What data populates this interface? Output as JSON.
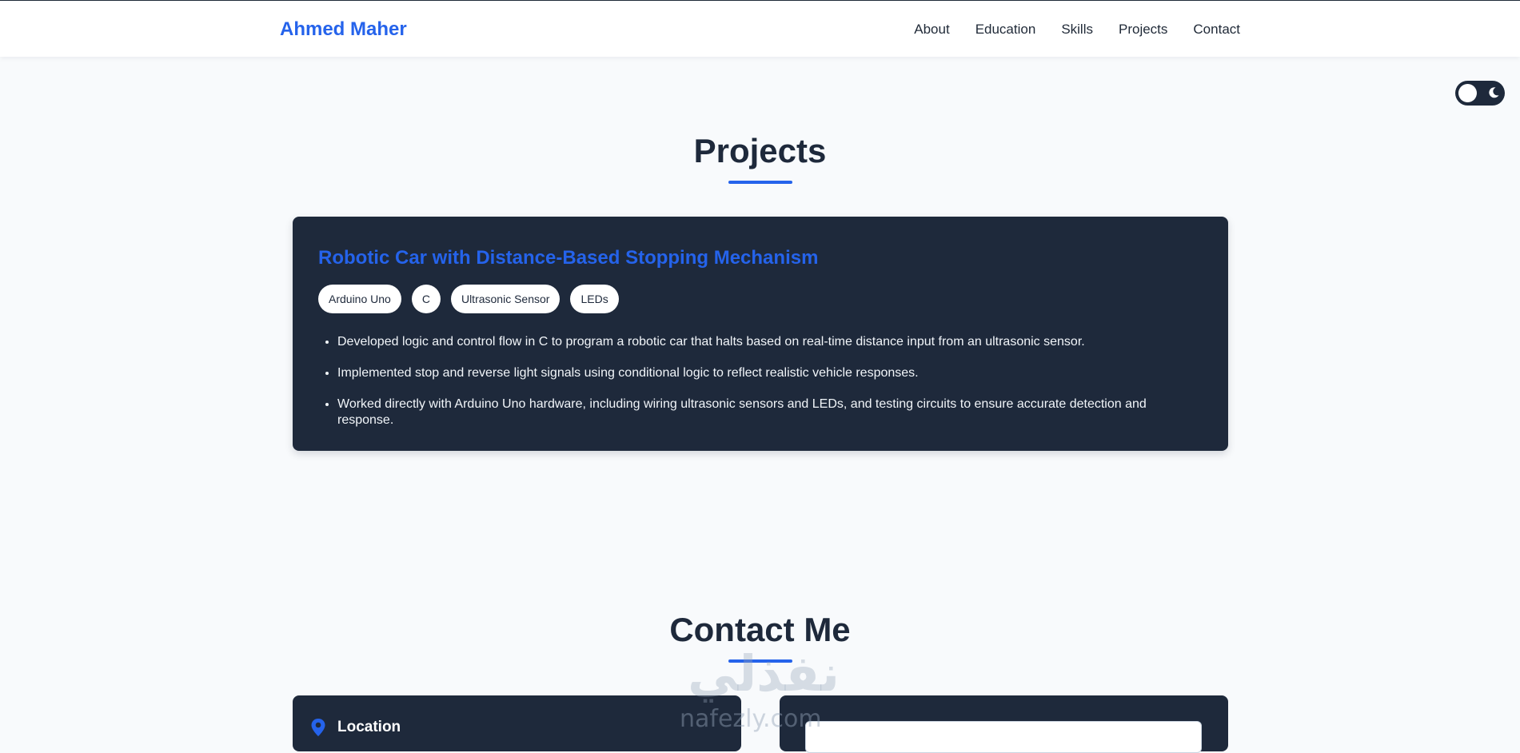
{
  "header": {
    "brand": "Ahmed Maher",
    "nav": [
      "About",
      "Education",
      "Skills",
      "Projects",
      "Contact"
    ]
  },
  "projects_section": {
    "title": "Projects",
    "project": {
      "title": "Robotic Car with Distance-Based Stopping Mechanism",
      "tags": [
        "Arduino Uno",
        "C",
        "Ultrasonic Sensor",
        "LEDs"
      ],
      "bullets": [
        "Developed logic and control flow in C to program a robotic car that halts based on real-time distance input from an ultrasonic sensor.",
        "Implemented stop and reverse light signals using conditional logic to reflect realistic vehicle responses.",
        "Worked directly with Arduino Uno hardware, including wiring ultrasonic sensors and LEDs, and testing circuits to ensure accurate detection and response."
      ]
    }
  },
  "contact_section": {
    "title": "Contact Me",
    "location_label": "Location"
  },
  "watermark": {
    "arabic": "نفذلي",
    "latin": "nafezly.com"
  },
  "theme": {
    "accent": "#2563eb",
    "card_bg": "#1e293b",
    "page_bg": "#f8fafc",
    "toggle_icon": "moon-icon"
  }
}
